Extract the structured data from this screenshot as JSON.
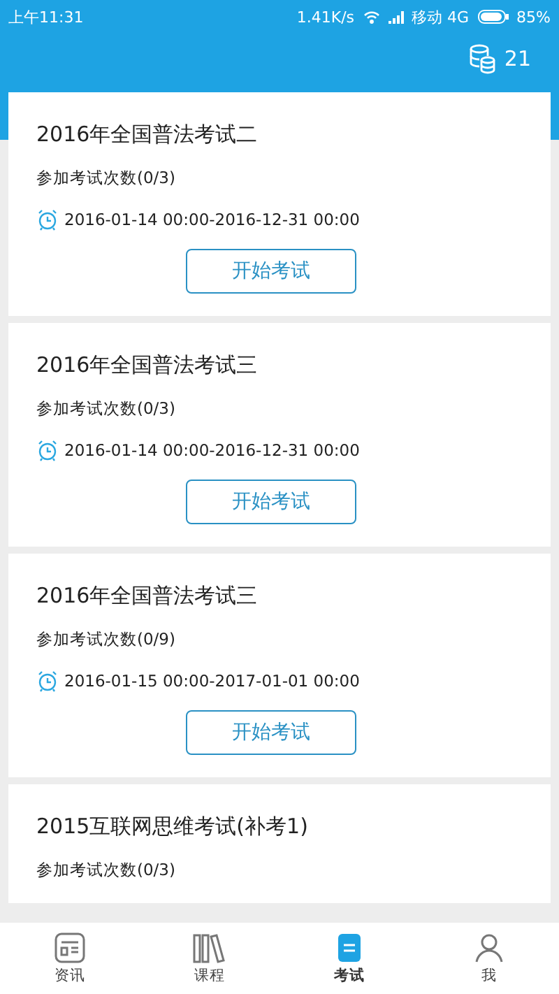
{
  "status_bar": {
    "time": "上午11:31",
    "speed": "1.41K/s",
    "carrier": "移动 4G",
    "battery": "85%"
  },
  "header": {
    "coins": "21"
  },
  "exams": [
    {
      "title": "2016年全国普法考试二",
      "attempts": "参加考试次数(0/3)",
      "period": "2016-01-14 00:00-2016-12-31 00:00",
      "button": "开始考试"
    },
    {
      "title": "2016年全国普法考试三",
      "attempts": "参加考试次数(0/3)",
      "period": "2016-01-14 00:00-2016-12-31 00:00",
      "button": "开始考试"
    },
    {
      "title": "2016年全国普法考试三",
      "attempts": "参加考试次数(0/9)",
      "period": "2016-01-15 00:00-2017-01-01 00:00",
      "button": "开始考试"
    },
    {
      "title": "2015互联网思维考试(补考1)",
      "attempts": "参加考试次数(0/3)"
    }
  ],
  "tabs": [
    {
      "label": "资讯",
      "kind": "news",
      "selected": false
    },
    {
      "label": "课程",
      "kind": "books",
      "selected": false
    },
    {
      "label": "考试",
      "kind": "exam",
      "selected": true
    },
    {
      "label": "我",
      "kind": "me",
      "selected": false
    }
  ]
}
